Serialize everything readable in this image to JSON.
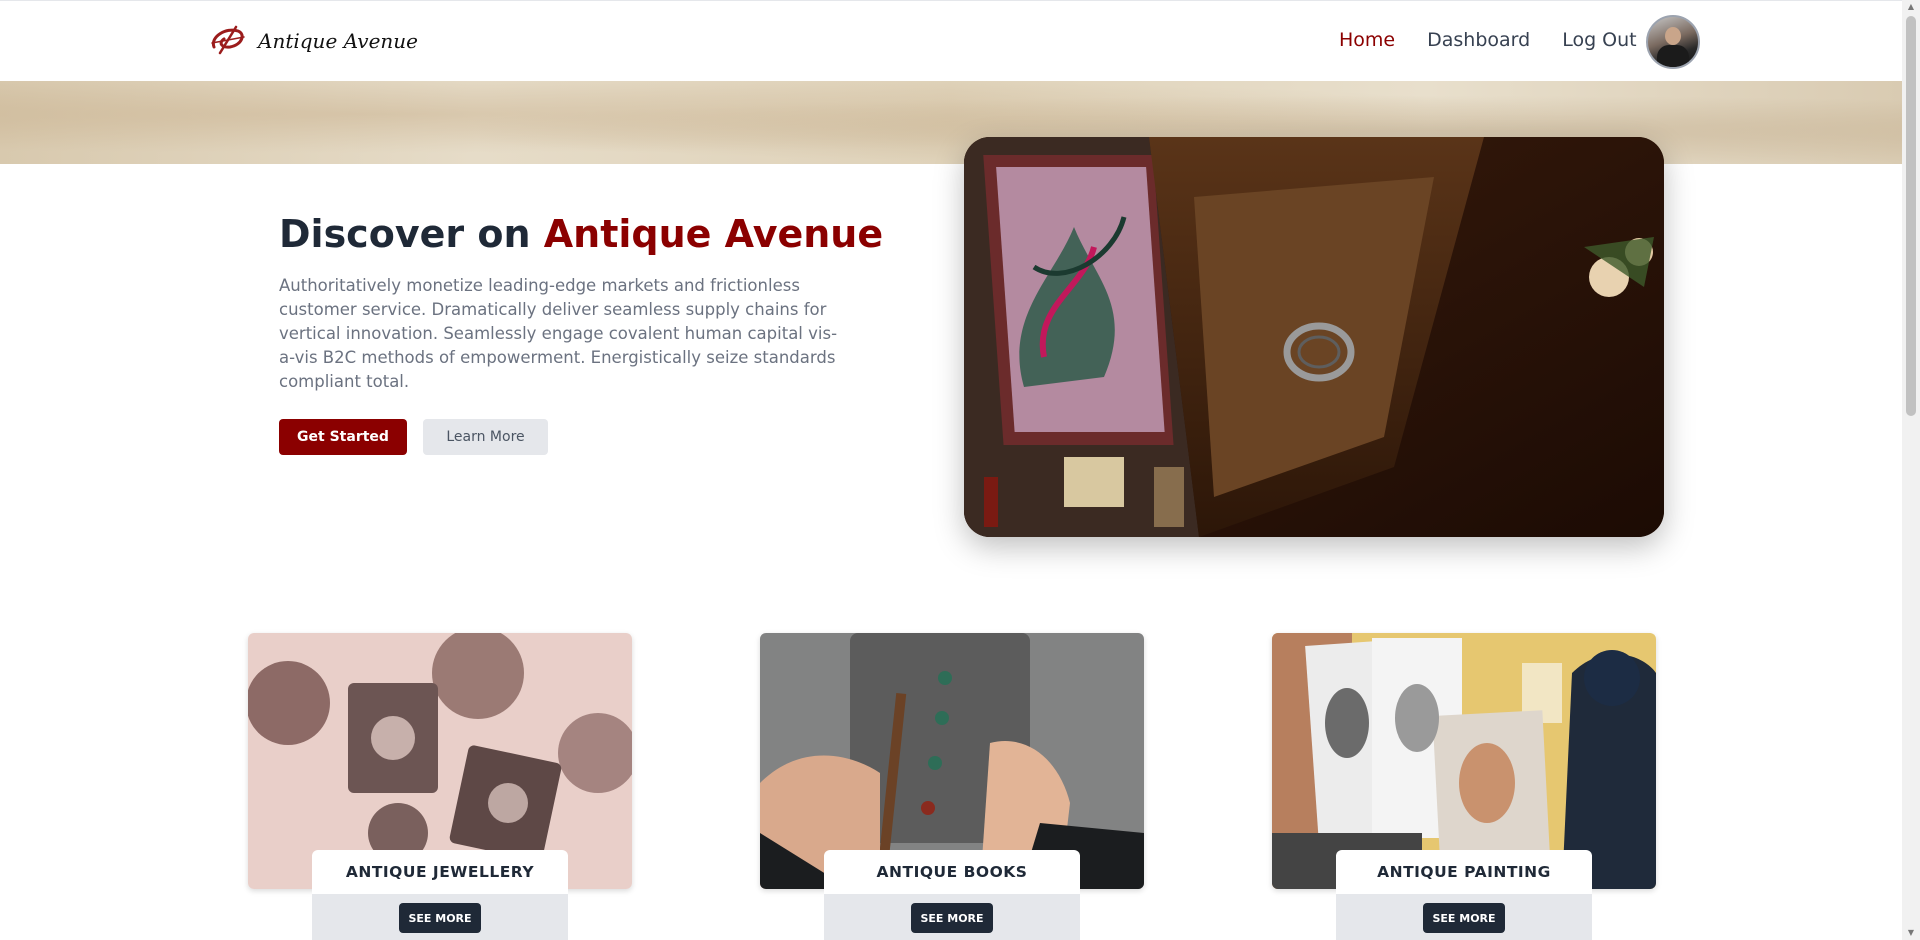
{
  "brand": {
    "name": "Antique Avenue",
    "logo_icon": "brand-swirl-logo"
  },
  "nav": {
    "links": [
      {
        "label": "Home",
        "active": true
      },
      {
        "label": "Dashboard",
        "active": false
      },
      {
        "label": "Log Out",
        "active": false
      }
    ],
    "avatar_icon": "user-avatar"
  },
  "hero": {
    "title_prefix": "Discover on ",
    "title_accent": "Antique Avenue",
    "description": "Authoritatively monetize leading-edge markets and frictionless customer service. Dramatically deliver seamless supply chains for vertical innovation. Seamlessly engage covalent human capital vis-a-vis B2C methods of empowerment. Energistically seize standards compliant total.",
    "primary_button": "Get Started",
    "secondary_button": "Learn More"
  },
  "categories": [
    {
      "label": "ANTIQUE JEWELLERY",
      "action": "SEE MORE"
    },
    {
      "label": "ANTIQUE BOOKS",
      "action": "SEE MORE"
    },
    {
      "label": "ANTIQUE PAINTING",
      "action": "SEE MORE"
    }
  ],
  "colors": {
    "accent": "#8b0000",
    "dark": "#1f2937",
    "muted": "#6b7280",
    "light_gray": "#e5e7eb"
  }
}
